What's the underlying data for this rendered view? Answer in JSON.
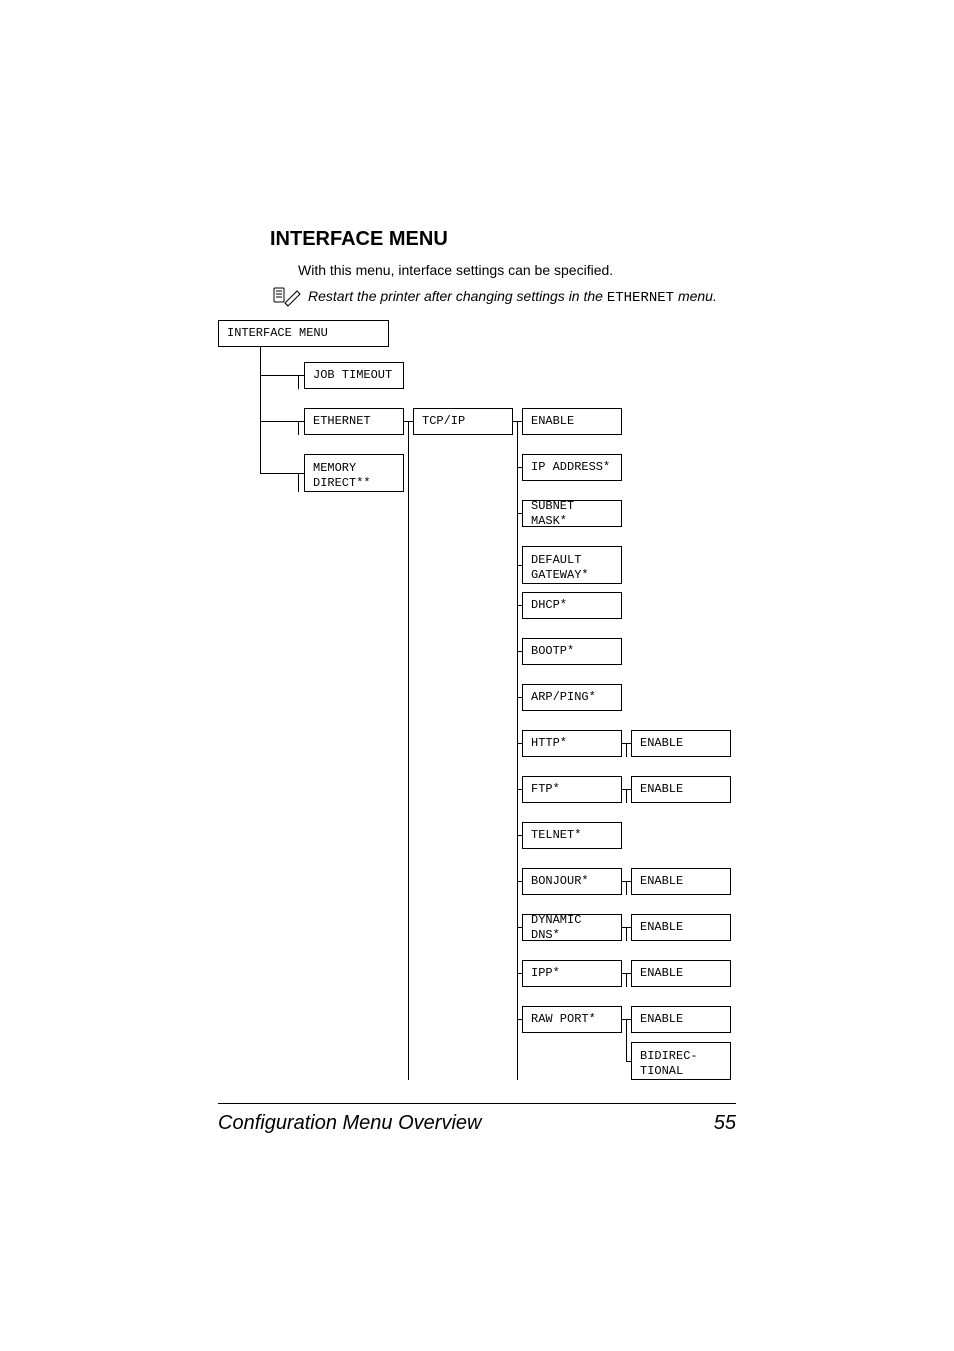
{
  "heading": "INTERFACE MENU",
  "intro": "With this menu, interface settings can be specified.",
  "note": {
    "prefix": "Restart the printer after changing settings in the ",
    "mono": "ETHERNET",
    "suffix": " menu."
  },
  "boxes": {
    "interface_menu": "INTERFACE MENU",
    "job_timeout": "JOB TIMEOUT",
    "ethernet": "ETHERNET",
    "memory_direct_l1": "MEMORY",
    "memory_direct_l2": "DIRECT**",
    "tcp_ip": "TCP/IP",
    "enable_tcpip": "ENABLE",
    "ip_address": "IP ADDRESS*",
    "subnet_mask": "SUBNET MASK*",
    "default_gateway_l1": "DEFAULT",
    "default_gateway_l2": "GATEWAY*",
    "dhcp": "DHCP*",
    "bootp": "BOOTP*",
    "arp_ping": "ARP/PING*",
    "http": "HTTP*",
    "enable_http": "ENABLE",
    "ftp": "FTP*",
    "enable_ftp": "ENABLE",
    "telnet": "TELNET*",
    "bonjour": "BONJOUR*",
    "enable_bonjour": "ENABLE",
    "dynamic_dns": "DYNAMIC DNS*",
    "enable_ddns": "ENABLE",
    "ipp": "IPP*",
    "enable_ipp": "ENABLE",
    "raw_port": "RAW PORT*",
    "enable_rawport": "ENABLE",
    "bidirectional_l1": "BIDIREC-",
    "bidirectional_l2": "TIONAL"
  },
  "footer": {
    "title": "Configuration Menu Overview",
    "page": "55"
  }
}
